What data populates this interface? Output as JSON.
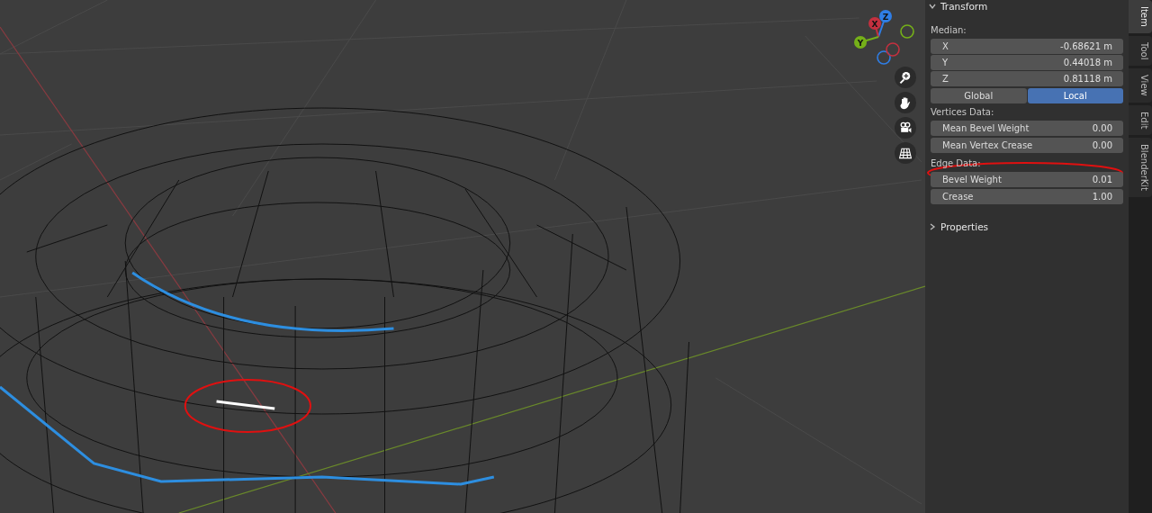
{
  "gizmo": {
    "axes": [
      {
        "label": "Z",
        "color": "#2f7ee6"
      },
      {
        "label": "X",
        "color": "#c4303f"
      },
      {
        "label": "Y",
        "color": "#75b019"
      }
    ]
  },
  "panel": {
    "sections": [
      {
        "title": "Transform",
        "expanded": true
      },
      {
        "title": "Properties",
        "expanded": false
      }
    ],
    "median_label": "Median:",
    "coords": [
      {
        "label": "X",
        "value": "-0.68621 m"
      },
      {
        "label": "Y",
        "value": "0.44018 m"
      },
      {
        "label": "Z",
        "value": "0.81118 m"
      }
    ],
    "space": [
      {
        "label": "Global",
        "selected": false
      },
      {
        "label": "Local",
        "selected": true
      }
    ],
    "vertices_label": "Vertices Data:",
    "vertices": [
      {
        "label": "Mean Bevel Weight",
        "value": "0.00"
      },
      {
        "label": "Mean Vertex Crease",
        "value": "0.00"
      }
    ],
    "edge_label": "Edge Data:",
    "edges": [
      {
        "label": "Bevel Weight",
        "value": "0.01"
      },
      {
        "label": "Crease",
        "value": "1.00"
      }
    ]
  },
  "tabs": [
    {
      "label": "Item",
      "selected": true
    },
    {
      "label": "Tool",
      "selected": false
    },
    {
      "label": "View",
      "selected": false
    },
    {
      "label": "Edit",
      "selected": false
    },
    {
      "label": "BlenderKit",
      "selected": false
    }
  ]
}
